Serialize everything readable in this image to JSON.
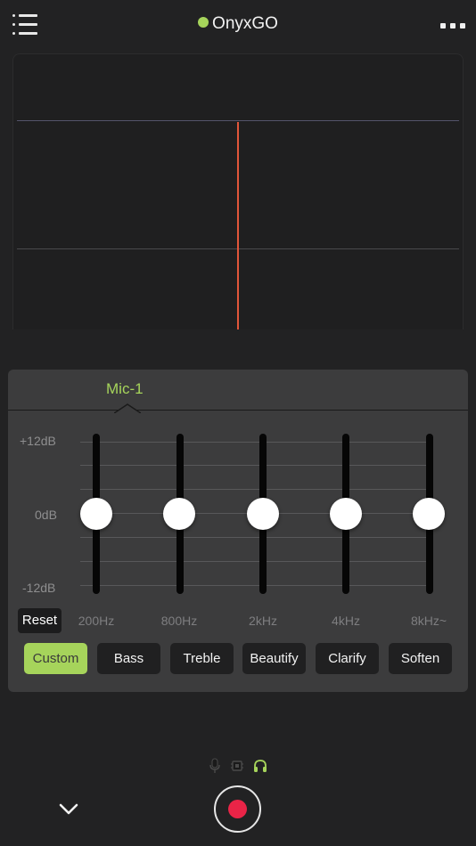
{
  "header": {
    "title": "OnyxGO",
    "menu_icon": "list-menu-icon",
    "more_icon": "more-horizontal-icon",
    "status_color": "#a6d45b"
  },
  "display": {
    "line_color": "#5a5a6a",
    "playhead_color": "#e2553a"
  },
  "eq": {
    "tab_label": "Mic-1",
    "db_labels": [
      "+12dB",
      "0dB",
      "-12dB"
    ],
    "bands": [
      {
        "label": "200Hz",
        "gain_db": 0
      },
      {
        "label": "800Hz",
        "gain_db": 0
      },
      {
        "label": "2kHz",
        "gain_db": 0
      },
      {
        "label": "4kHz",
        "gain_db": 0
      },
      {
        "label": "8kHz~",
        "gain_db": 0
      }
    ],
    "reset_label": "Reset",
    "presets": [
      "Custom",
      "Bass",
      "Treble",
      "Beautify",
      "Clarify",
      "Soften"
    ],
    "active_preset": "Custom",
    "accent_color": "#a6d45b"
  },
  "bottom": {
    "sources": [
      "microphone-icon",
      "chip-icon",
      "headphones-icon"
    ],
    "collapse_icon": "chevron-down-icon",
    "record_icon": "record-icon",
    "record_color": "#ea2447"
  }
}
